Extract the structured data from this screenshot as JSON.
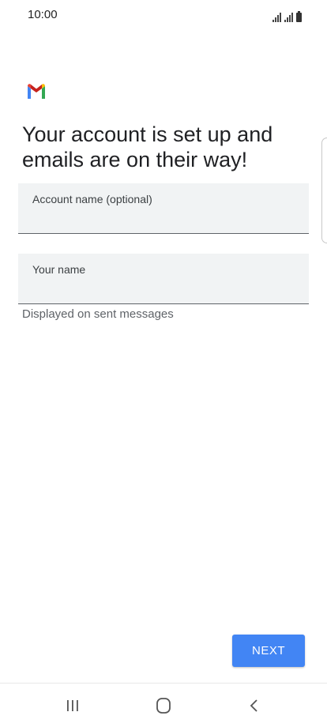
{
  "status_bar": {
    "time": "10:00"
  },
  "app": {
    "logo_icon": "gmail-logo-icon",
    "colors": {
      "accent": "#4285f4",
      "gmail_red": "#ea4335",
      "gmail_blue": "#4285f4",
      "gmail_green": "#34a853",
      "gmail_yellow": "#fbbc04"
    }
  },
  "title": "Your account is set up and emails are on their way!",
  "form": {
    "account_name": {
      "label": "Account name (optional)",
      "value": ""
    },
    "your_name": {
      "label": "Your name",
      "value": "",
      "helper": "Displayed on sent messages"
    }
  },
  "actions": {
    "next_label": "NEXT"
  },
  "nav": {
    "recent_icon": "recent-apps-icon",
    "home_icon": "home-icon",
    "back_icon": "back-icon"
  }
}
